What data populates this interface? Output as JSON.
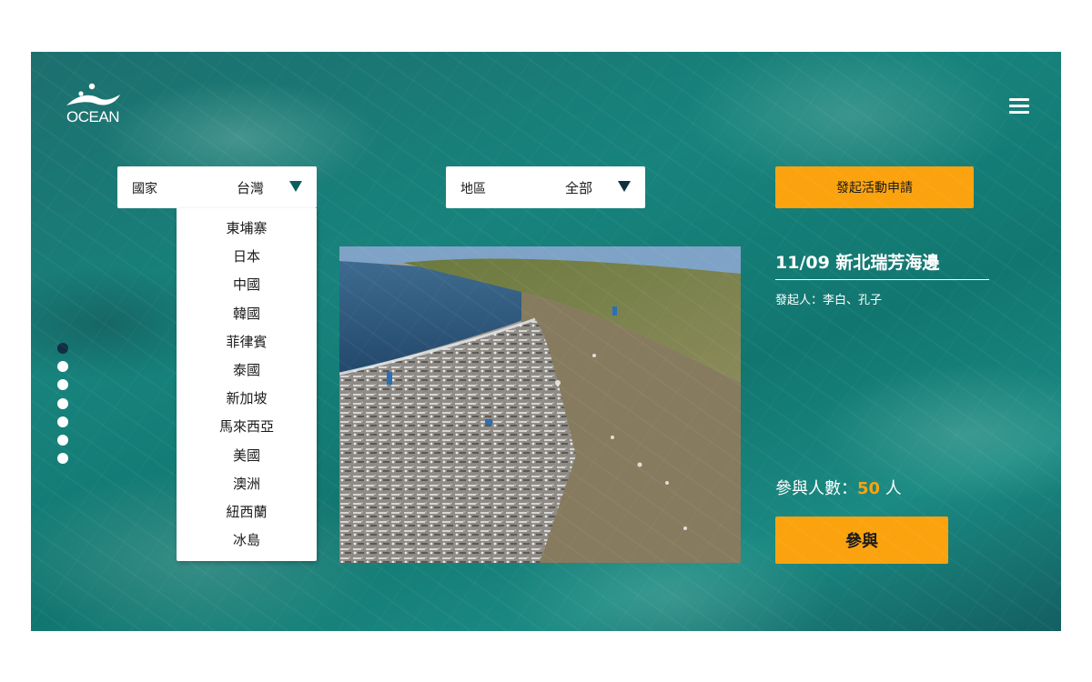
{
  "brand": {
    "logo_text": "OCEAN"
  },
  "header": {
    "menu_icon": "hamburger-menu-icon"
  },
  "filters": {
    "country": {
      "label": "國家",
      "value": "台灣",
      "caret_icon": "caret-down-icon",
      "caret_color": "#0d5d5c"
    },
    "region": {
      "label": "地區",
      "value": "全部",
      "caret_icon": "caret-down-icon",
      "caret_color": "#103040"
    },
    "country_options": [
      "東埔寨",
      "日本",
      "中國",
      "韓國",
      "菲律賓",
      "泰國",
      "新加坡",
      "馬來西亞",
      "美國",
      "澳洲",
      "紐西蘭",
      "冰島"
    ]
  },
  "actions": {
    "apply_label": "發起活動申請",
    "join_label": "參與"
  },
  "pagination": {
    "total": 7,
    "active_index": 0
  },
  "event": {
    "title": "11/09 新北瑞芳海邊",
    "organizer": "發起人：李白、孔子",
    "participants_prefix": "參與人數：",
    "participants_count": "50",
    "participants_suffix": " 人"
  },
  "colors": {
    "accent": "#fba30e",
    "ocean_teal": "#17837c",
    "active_dot": "#112d44",
    "text_dark": "#1a1a1a"
  }
}
